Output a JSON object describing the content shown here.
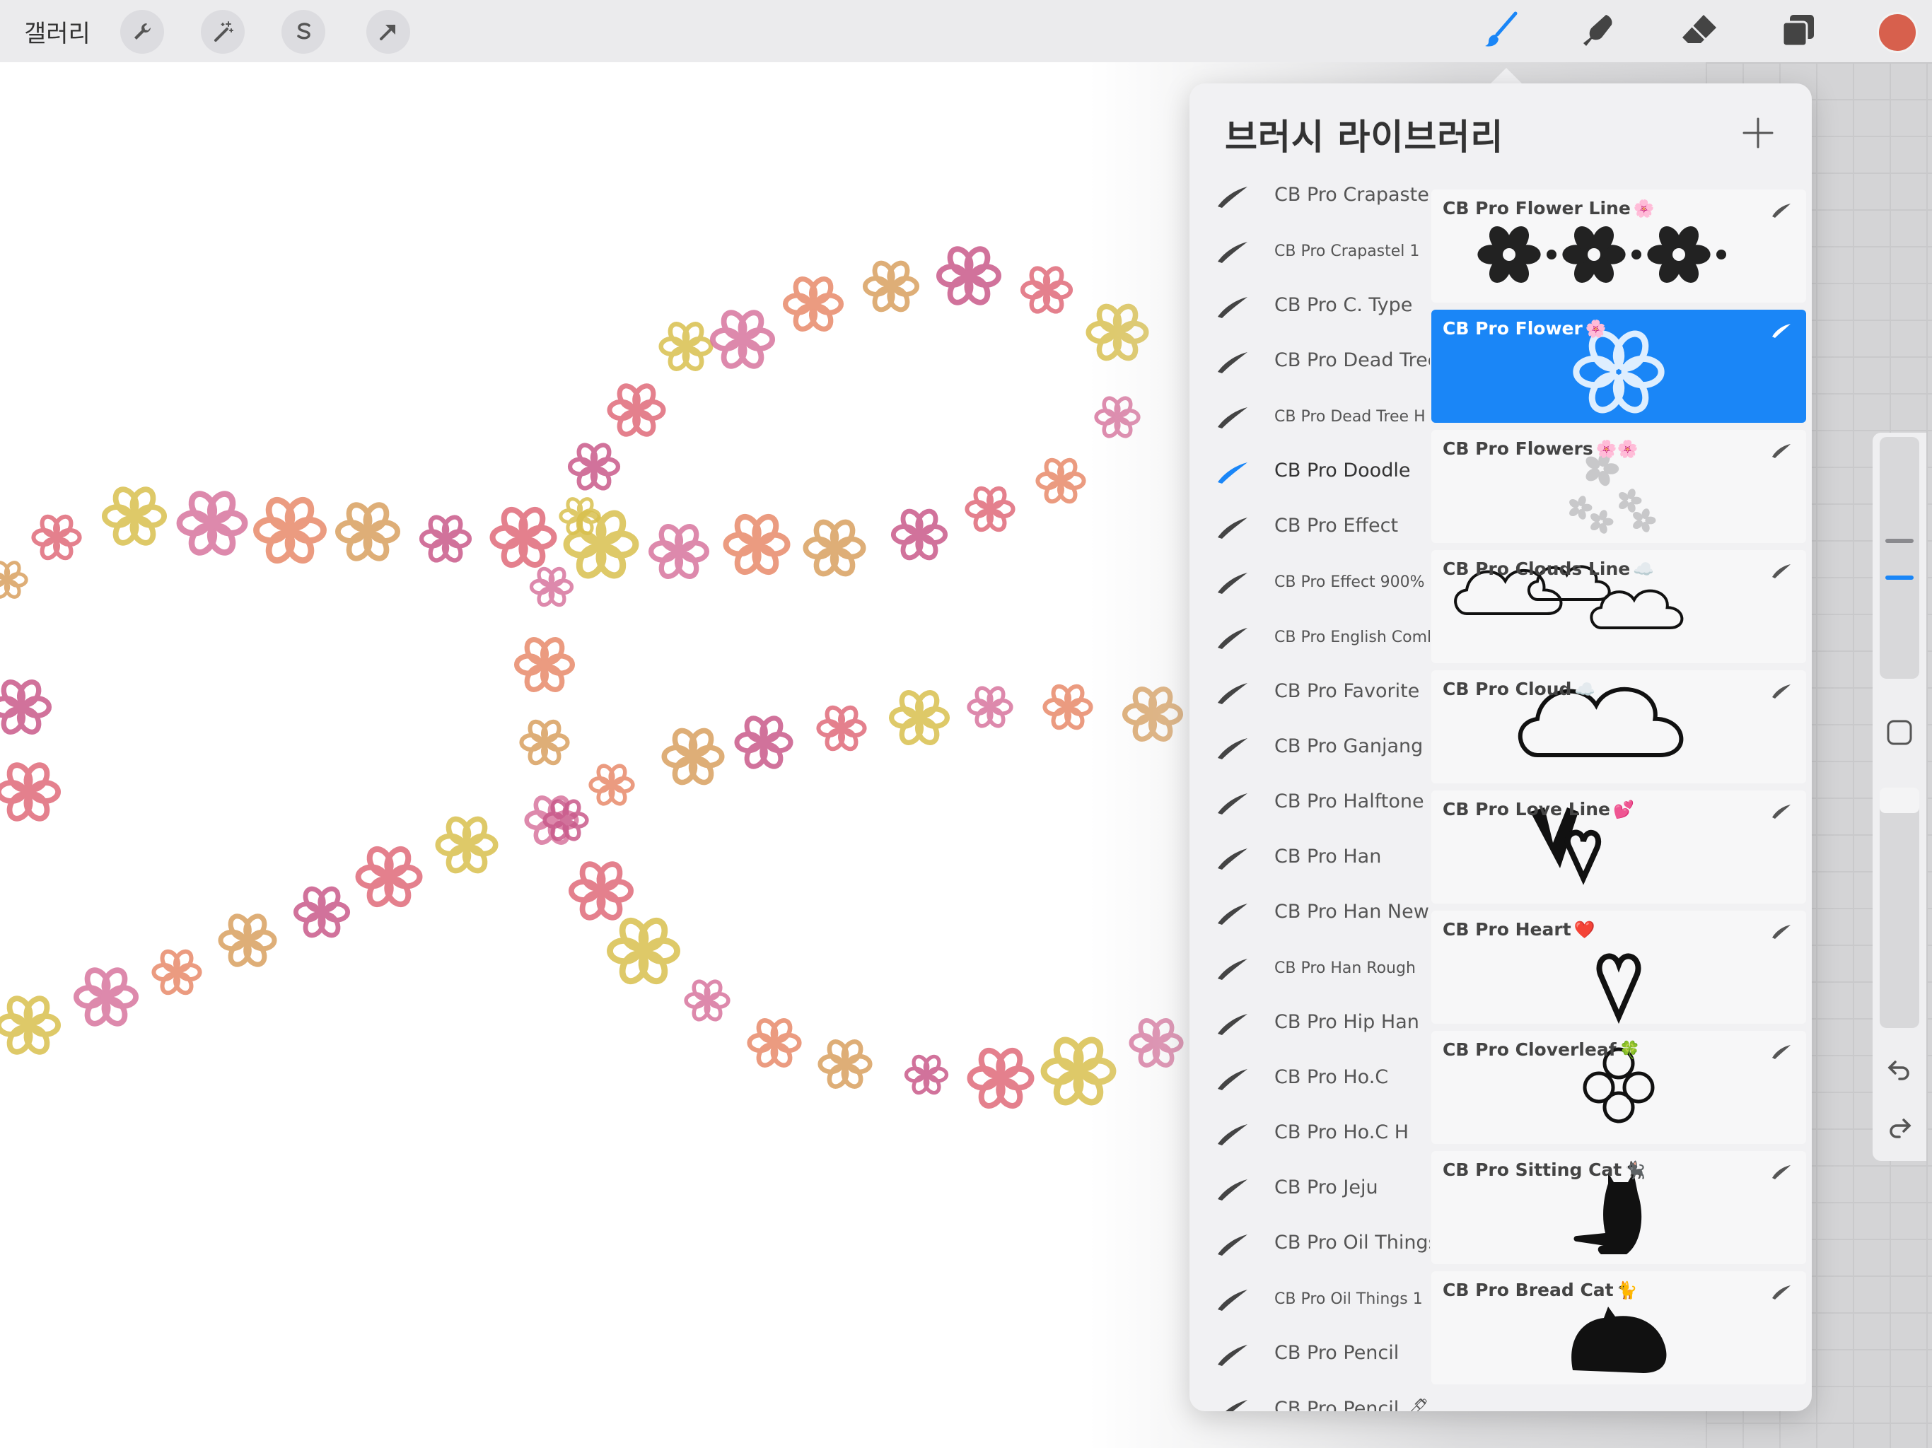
{
  "toolbar": {
    "gallery_label": "갤러리",
    "left_tools": [
      {
        "name": "actions-wrench-icon"
      },
      {
        "name": "adjustments-wand-icon"
      },
      {
        "name": "selection-s-icon"
      },
      {
        "name": "transform-arrow-icon"
      }
    ],
    "right_tools": [
      {
        "name": "paint-brush-icon",
        "active": true
      },
      {
        "name": "smudge-icon",
        "active": false
      },
      {
        "name": "eraser-icon",
        "active": false
      },
      {
        "name": "layers-icon",
        "active": false
      }
    ],
    "active_color": "#d7604d",
    "accent_color": "#1a86f7"
  },
  "brush_library": {
    "title": "브러시 라이브러리",
    "add_icon": "plus-icon",
    "brush_sets": [
      {
        "label": "CB Pro Crapastel",
        "small": false,
        "active": false
      },
      {
        "label": "CB Pro Crapastel 1",
        "small": true,
        "active": false
      },
      {
        "label": "CB Pro C. Type",
        "small": false,
        "active": false
      },
      {
        "label": "CB Pro Dead Tree",
        "small": false,
        "active": false
      },
      {
        "label": "CB Pro Dead Tree H",
        "small": true,
        "active": false
      },
      {
        "label": "CB Pro Doodle",
        "small": false,
        "active": true
      },
      {
        "label": "CB Pro Effect",
        "small": false,
        "active": false
      },
      {
        "label": "CB Pro Effect 900%",
        "small": true,
        "active": false
      },
      {
        "label": "CB Pro English Comb",
        "small": true,
        "active": false
      },
      {
        "label": "CB Pro Favorite",
        "small": false,
        "active": false
      },
      {
        "label": "CB Pro Ganjang",
        "small": false,
        "active": false
      },
      {
        "label": "CB Pro Halftone",
        "small": false,
        "active": false
      },
      {
        "label": "CB Pro Han",
        "small": false,
        "active": false
      },
      {
        "label": "CB Pro Han New",
        "small": false,
        "active": false
      },
      {
        "label": "CB Pro Han Rough",
        "small": true,
        "active": false
      },
      {
        "label": "CB Pro Hip Han",
        "small": false,
        "active": false
      },
      {
        "label": "CB Pro Ho.C",
        "small": false,
        "active": false
      },
      {
        "label": "CB Pro Ho.C H",
        "small": false,
        "active": false
      },
      {
        "label": "CB Pro Jeju",
        "small": false,
        "active": false
      },
      {
        "label": "CB Pro Oil Things",
        "small": false,
        "active": false
      },
      {
        "label": "CB Pro Oil Things 1",
        "small": true,
        "active": false
      },
      {
        "label": "CB Pro Pencil",
        "small": false,
        "active": false
      },
      {
        "label": "CB Pro Pencil 🖊",
        "small": false,
        "active": false
      }
    ],
    "brushes": [
      {
        "name": "CB Pro Flower Line",
        "emoji": "🌸",
        "selected": false,
        "preview": "flower-line"
      },
      {
        "name": "CB Pro Flower",
        "emoji": "🌸",
        "selected": true,
        "preview": "flower"
      },
      {
        "name": "CB Pro Flowers",
        "emoji": "🌸🌸",
        "selected": false,
        "preview": "flowers"
      },
      {
        "name": "CB Pro Clouds Line",
        "emoji": "☁️",
        "selected": false,
        "preview": "clouds-line"
      },
      {
        "name": "CB Pro Cloud",
        "emoji": "☁️",
        "selected": false,
        "preview": "cloud"
      },
      {
        "name": "CB Pro Love Line",
        "emoji": "💕",
        "selected": false,
        "preview": "love-line"
      },
      {
        "name": "CB Pro Heart",
        "emoji": "❤️",
        "selected": false,
        "preview": "heart"
      },
      {
        "name": "CB Pro Cloverleaf",
        "emoji": "🍀",
        "selected": false,
        "preview": "cloverleaf"
      },
      {
        "name": "CB Pro Sitting Cat",
        "emoji": "🐈‍⬛",
        "selected": false,
        "preview": "sitting-cat"
      },
      {
        "name": "CB Pro Bread Cat",
        "emoji": "🐈",
        "selected": false,
        "preview": "bread-cat"
      }
    ]
  },
  "side_controls": {
    "brush_size_icon": "size-slider",
    "modify_button_icon": "square-modify-icon",
    "opacity_icon": "opacity-slider",
    "undo_icon": "undo-icon",
    "redo_icon": "redo-icon"
  },
  "canvas": {
    "content": "flower-doodle-strokes",
    "flower_colors": [
      "#e06a7a",
      "#d9c04e",
      "#d8759e",
      "#e88a6a",
      "#d9a060",
      "#c95a8a"
    ]
  }
}
